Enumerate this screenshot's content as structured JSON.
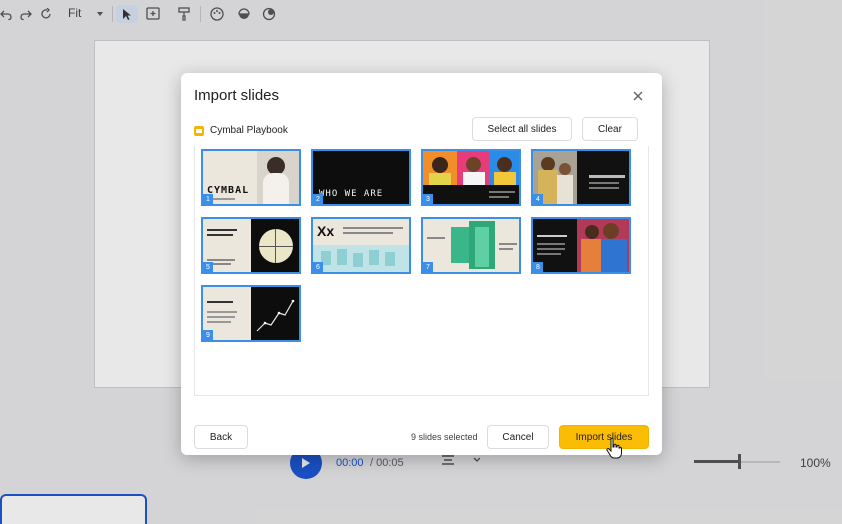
{
  "app": {
    "toolbar": {
      "zoom_mode": "Fit",
      "icons": [
        "undo-icon",
        "redo-icon",
        "chevron-down-icon",
        "pointer-icon",
        "add-box-icon",
        "paint-format-icon",
        "palette-icon",
        "fill-icon",
        "theme-icon"
      ]
    },
    "player": {
      "current_time": "00:00",
      "separator_total": "/ 00:05",
      "zoom_percent": "100%"
    }
  },
  "dialog": {
    "title": "Import slides",
    "close_label": "×",
    "file_name": "Cymbal Playbook",
    "select_all_label": "Select all slides",
    "clear_label": "Clear",
    "slides": [
      {
        "number": "1",
        "heading": "CYMBAL",
        "selected": true
      },
      {
        "number": "2",
        "heading": "WHO WE ARE",
        "selected": true
      },
      {
        "number": "3",
        "heading": "",
        "selected": true
      },
      {
        "number": "4",
        "heading": "",
        "selected": true
      },
      {
        "number": "5",
        "heading": "",
        "selected": true
      },
      {
        "number": "6",
        "heading": "Xx",
        "selected": true
      },
      {
        "number": "7",
        "heading": "",
        "selected": true
      },
      {
        "number": "8",
        "heading": "",
        "selected": true
      },
      {
        "number": "9",
        "heading": "",
        "selected": true
      }
    ],
    "selection_status": "9 slides selected",
    "back_label": "Back",
    "cancel_label": "Cancel",
    "import_label": "Import slides"
  },
  "colors": {
    "accent_blue": "#1a56d6",
    "selection_blue": "#3b8fe8",
    "import_yellow": "#fbbc04",
    "file_icon_yellow": "#f4b400"
  }
}
